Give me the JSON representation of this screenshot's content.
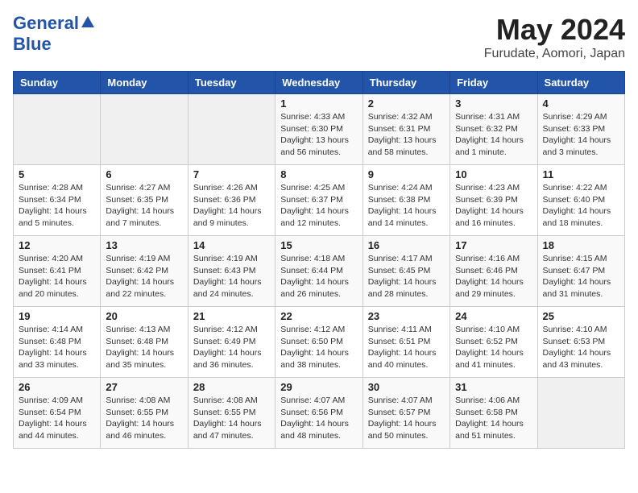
{
  "header": {
    "logo_line1": "General",
    "logo_line2": "Blue",
    "title": "May 2024",
    "location": "Furudate, Aomori, Japan"
  },
  "weekdays": [
    "Sunday",
    "Monday",
    "Tuesday",
    "Wednesday",
    "Thursday",
    "Friday",
    "Saturday"
  ],
  "weeks": [
    [
      {
        "date": "",
        "info": ""
      },
      {
        "date": "",
        "info": ""
      },
      {
        "date": "",
        "info": ""
      },
      {
        "date": "1",
        "info": "Sunrise: 4:33 AM\nSunset: 6:30 PM\nDaylight: 13 hours\nand 56 minutes."
      },
      {
        "date": "2",
        "info": "Sunrise: 4:32 AM\nSunset: 6:31 PM\nDaylight: 13 hours\nand 58 minutes."
      },
      {
        "date": "3",
        "info": "Sunrise: 4:31 AM\nSunset: 6:32 PM\nDaylight: 14 hours\nand 1 minute."
      },
      {
        "date": "4",
        "info": "Sunrise: 4:29 AM\nSunset: 6:33 PM\nDaylight: 14 hours\nand 3 minutes."
      }
    ],
    [
      {
        "date": "5",
        "info": "Sunrise: 4:28 AM\nSunset: 6:34 PM\nDaylight: 14 hours\nand 5 minutes."
      },
      {
        "date": "6",
        "info": "Sunrise: 4:27 AM\nSunset: 6:35 PM\nDaylight: 14 hours\nand 7 minutes."
      },
      {
        "date": "7",
        "info": "Sunrise: 4:26 AM\nSunset: 6:36 PM\nDaylight: 14 hours\nand 9 minutes."
      },
      {
        "date": "8",
        "info": "Sunrise: 4:25 AM\nSunset: 6:37 PM\nDaylight: 14 hours\nand 12 minutes."
      },
      {
        "date": "9",
        "info": "Sunrise: 4:24 AM\nSunset: 6:38 PM\nDaylight: 14 hours\nand 14 minutes."
      },
      {
        "date": "10",
        "info": "Sunrise: 4:23 AM\nSunset: 6:39 PM\nDaylight: 14 hours\nand 16 minutes."
      },
      {
        "date": "11",
        "info": "Sunrise: 4:22 AM\nSunset: 6:40 PM\nDaylight: 14 hours\nand 18 minutes."
      }
    ],
    [
      {
        "date": "12",
        "info": "Sunrise: 4:20 AM\nSunset: 6:41 PM\nDaylight: 14 hours\nand 20 minutes."
      },
      {
        "date": "13",
        "info": "Sunrise: 4:19 AM\nSunset: 6:42 PM\nDaylight: 14 hours\nand 22 minutes."
      },
      {
        "date": "14",
        "info": "Sunrise: 4:19 AM\nSunset: 6:43 PM\nDaylight: 14 hours\nand 24 minutes."
      },
      {
        "date": "15",
        "info": "Sunrise: 4:18 AM\nSunset: 6:44 PM\nDaylight: 14 hours\nand 26 minutes."
      },
      {
        "date": "16",
        "info": "Sunrise: 4:17 AM\nSunset: 6:45 PM\nDaylight: 14 hours\nand 28 minutes."
      },
      {
        "date": "17",
        "info": "Sunrise: 4:16 AM\nSunset: 6:46 PM\nDaylight: 14 hours\nand 29 minutes."
      },
      {
        "date": "18",
        "info": "Sunrise: 4:15 AM\nSunset: 6:47 PM\nDaylight: 14 hours\nand 31 minutes."
      }
    ],
    [
      {
        "date": "19",
        "info": "Sunrise: 4:14 AM\nSunset: 6:48 PM\nDaylight: 14 hours\nand 33 minutes."
      },
      {
        "date": "20",
        "info": "Sunrise: 4:13 AM\nSunset: 6:48 PM\nDaylight: 14 hours\nand 35 minutes."
      },
      {
        "date": "21",
        "info": "Sunrise: 4:12 AM\nSunset: 6:49 PM\nDaylight: 14 hours\nand 36 minutes."
      },
      {
        "date": "22",
        "info": "Sunrise: 4:12 AM\nSunset: 6:50 PM\nDaylight: 14 hours\nand 38 minutes."
      },
      {
        "date": "23",
        "info": "Sunrise: 4:11 AM\nSunset: 6:51 PM\nDaylight: 14 hours\nand 40 minutes."
      },
      {
        "date": "24",
        "info": "Sunrise: 4:10 AM\nSunset: 6:52 PM\nDaylight: 14 hours\nand 41 minutes."
      },
      {
        "date": "25",
        "info": "Sunrise: 4:10 AM\nSunset: 6:53 PM\nDaylight: 14 hours\nand 43 minutes."
      }
    ],
    [
      {
        "date": "26",
        "info": "Sunrise: 4:09 AM\nSunset: 6:54 PM\nDaylight: 14 hours\nand 44 minutes."
      },
      {
        "date": "27",
        "info": "Sunrise: 4:08 AM\nSunset: 6:55 PM\nDaylight: 14 hours\nand 46 minutes."
      },
      {
        "date": "28",
        "info": "Sunrise: 4:08 AM\nSunset: 6:55 PM\nDaylight: 14 hours\nand 47 minutes."
      },
      {
        "date": "29",
        "info": "Sunrise: 4:07 AM\nSunset: 6:56 PM\nDaylight: 14 hours\nand 48 minutes."
      },
      {
        "date": "30",
        "info": "Sunrise: 4:07 AM\nSunset: 6:57 PM\nDaylight: 14 hours\nand 50 minutes."
      },
      {
        "date": "31",
        "info": "Sunrise: 4:06 AM\nSunset: 6:58 PM\nDaylight: 14 hours\nand 51 minutes."
      },
      {
        "date": "",
        "info": ""
      }
    ]
  ]
}
